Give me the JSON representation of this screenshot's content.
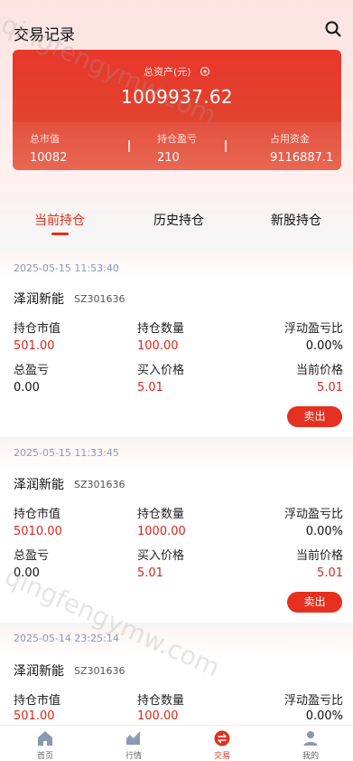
{
  "header": {
    "title": "交易记录"
  },
  "assets": {
    "total_label": "总资产(元)",
    "total_value": "1009937.62",
    "stats": [
      {
        "label": "总市值",
        "value": "10082"
      },
      {
        "label": "持仓盈亏",
        "value": "210"
      },
      {
        "label": "占用资金",
        "value": "9116887.1"
      }
    ]
  },
  "tabs": [
    "当前持仓",
    "历史持仓",
    "新股持仓"
  ],
  "positions": [
    {
      "time": "2025-05-15 11:53:40",
      "name": "泽润新能",
      "code": "SZ301636",
      "labels": [
        "持仓市值",
        "持仓数量",
        "浮动盈亏比",
        "总盈亏",
        "买入价格",
        "当前价格"
      ],
      "values": [
        "501.00",
        "100.00",
        "0.00%",
        "0.00",
        "5.01",
        "5.01"
      ],
      "action": "卖出"
    },
    {
      "time": "2025-05-15 11:33:45",
      "name": "泽润新能",
      "code": "SZ301636",
      "labels": [
        "持仓市值",
        "持仓数量",
        "浮动盈亏比",
        "总盈亏",
        "买入价格",
        "当前价格"
      ],
      "values": [
        "5010.00",
        "1000.00",
        "0.00%",
        "0.00",
        "5.01",
        "5.01"
      ],
      "action": "卖出"
    },
    {
      "time": "2025-05-14 23:25:14",
      "name": "泽润新能",
      "code": "SZ301636",
      "labels": [
        "持仓市值",
        "持仓数量",
        "浮动盈亏比"
      ],
      "values": [
        "501.00",
        "100.00",
        "0.00%"
      ]
    }
  ],
  "tabbar": [
    {
      "label": "首页",
      "icon": "home-icon"
    },
    {
      "label": "行情",
      "icon": "chart-icon"
    },
    {
      "label": "交易",
      "icon": "trade-icon"
    },
    {
      "label": "我的",
      "icon": "user-icon"
    }
  ],
  "watermark": "qingfengymw.com",
  "colors": {
    "accent": "#e0301e",
    "card": "#e5392a"
  }
}
